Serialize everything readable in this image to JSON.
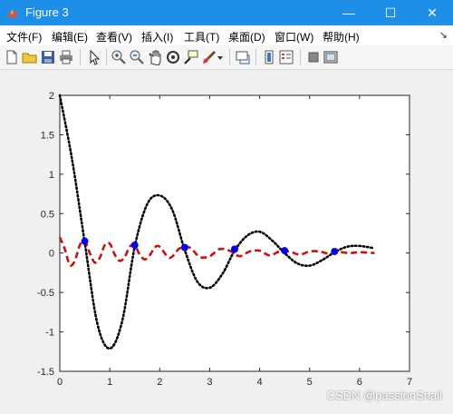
{
  "window": {
    "title": "Figure 3",
    "minimize_glyph": "—",
    "maximize_glyph": "☐",
    "close_glyph": "✕"
  },
  "menu": [
    {
      "label": "文件(F)"
    },
    {
      "label": "编辑(E)"
    },
    {
      "label": "查看(V)"
    },
    {
      "label": "插入(I)"
    },
    {
      "label": "工具(T)"
    },
    {
      "label": "桌面(D)"
    },
    {
      "label": "窗口(W)"
    },
    {
      "label": "帮助(H)"
    }
  ],
  "menu_overflow_glyph": "↘",
  "toolbar_icons": [
    "new-figure-icon",
    "open-file-icon",
    "save-icon",
    "print-icon",
    "edit-plot-arrow-icon",
    "zoom-in-icon",
    "zoom-out-icon",
    "pan-hand-icon",
    "rotate-3d-icon",
    "data-cursor-icon",
    "brush-icon",
    "brush-dropdown-icon",
    "link-plot-icon",
    "insert-colorbar-icon",
    "insert-legend-icon",
    "hide-plot-tools-icon",
    "show-plot-tools-icon"
  ],
  "watermark": "CSDN @passionSnail",
  "chart_data": {
    "type": "line",
    "xlim": [
      0,
      7
    ],
    "ylim": [
      -1.5,
      2
    ],
    "xticks": [
      "0",
      "1",
      "2",
      "3",
      "4",
      "5",
      "6",
      "7"
    ],
    "yticks": [
      "-1.5",
      "-1",
      "-0.5",
      "0",
      "0.5",
      "1",
      "1.5",
      "2"
    ],
    "grid": false,
    "series": [
      {
        "style": "dotted",
        "color": "#000000",
        "x": [
          0,
          0.25,
          0.5,
          0.75,
          1.0,
          1.25,
          1.5,
          1.75,
          2.0,
          2.25,
          2.5,
          2.75,
          3.0,
          3.25,
          3.5,
          3.75,
          4.0,
          4.25,
          4.5,
          4.75,
          5.0,
          5.25,
          5.5,
          5.75,
          6.0,
          6.3
        ],
        "y": [
          2.0,
          1.17,
          0.13,
          -0.89,
          -1.21,
          -0.86,
          0.08,
          0.62,
          0.73,
          0.55,
          0.04,
          -0.36,
          -0.44,
          -0.27,
          0.03,
          0.22,
          0.27,
          0.16,
          0.0,
          -0.13,
          -0.16,
          -0.09,
          0.01,
          0.08,
          0.09,
          0.06
        ]
      },
      {
        "style": "dashed",
        "color": "#cc1010",
        "x": [
          0,
          0.1,
          0.2,
          0.3,
          0.4,
          0.5,
          0.6,
          0.7,
          0.8,
          0.9,
          1.0,
          1.1,
          1.2,
          1.3,
          1.4,
          1.5,
          1.6,
          1.7,
          1.8,
          1.9,
          2.0,
          2.2,
          2.4,
          2.6,
          2.8,
          3.0,
          3.2,
          3.4,
          3.6,
          3.8,
          4.0,
          4.2,
          4.4,
          4.6,
          4.8,
          5.0,
          5.2,
          5.4,
          5.6,
          5.8,
          6.0,
          6.3
        ],
        "y": [
          0.2,
          0.05,
          -0.15,
          -0.1,
          0.1,
          0.15,
          0.0,
          -0.12,
          -0.06,
          0.1,
          0.12,
          -0.02,
          -0.1,
          -0.05,
          0.08,
          0.1,
          -0.02,
          -0.08,
          -0.03,
          0.07,
          0.08,
          -0.06,
          0.06,
          0.07,
          -0.05,
          -0.04,
          0.05,
          0.03,
          -0.04,
          0.02,
          0.03,
          -0.03,
          0.02,
          0.02,
          -0.02,
          0.02,
          0.02,
          -0.01,
          0.01,
          0.0,
          0.01,
          0.0
        ]
      },
      {
        "style": "markers",
        "color": "#0000ee",
        "x": [
          0.5,
          1.5,
          2.5,
          3.5,
          4.5,
          5.5
        ],
        "y": [
          0.15,
          0.1,
          0.07,
          0.05,
          0.03,
          0.02
        ]
      }
    ]
  }
}
